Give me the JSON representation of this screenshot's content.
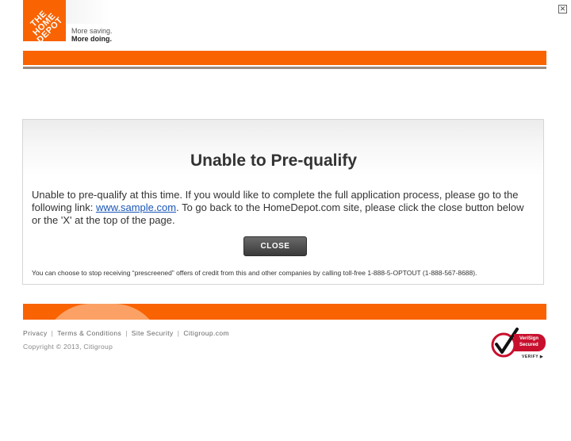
{
  "header": {
    "logo_text": "THE HOME DEPOT",
    "tagline_line1": "More saving.",
    "tagline_line2": "More doing."
  },
  "window": {
    "close_glyph": "✕"
  },
  "dialog": {
    "title": "Unable to Pre-qualify",
    "message_part1": "Unable to pre-qualify at this time. If you would like to complete the full application process, please go to the following link: ",
    "link_text": "www.sample.com",
    "message_part2": ". To go back to the HomeDepot.com site, please click the close button below or the 'X' at the top of the page.",
    "close_label": "CLOSE",
    "disclaimer": "You can choose to stop receiving “prescreened” offers of credit from this and other companies by calling toll-free 1-888-5-OPTOUT (1-888-567-8688)."
  },
  "footer": {
    "links": [
      "Privacy",
      "Terms & Conditions",
      "Site Security",
      "Citigroup.com"
    ],
    "separator": "|",
    "copyright": "Copyright © 2013, Citigroup"
  },
  "badge": {
    "line1": "VeriSign",
    "line2": "Secured",
    "verify": "VERIFY ▶"
  },
  "colors": {
    "brand_orange": "#f96302",
    "link_blue": "#1a56b8",
    "verisign_red": "#c8102e"
  }
}
